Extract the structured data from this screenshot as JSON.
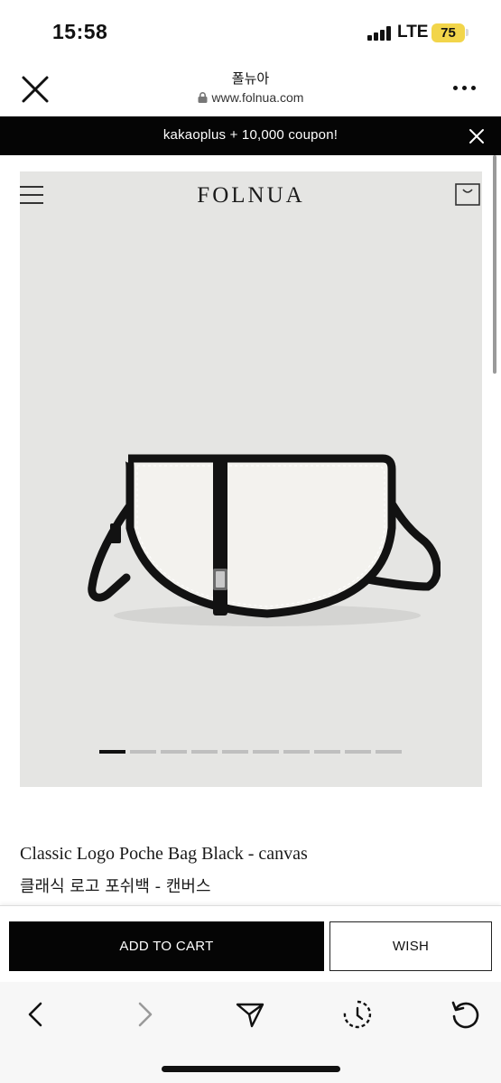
{
  "status_bar": {
    "time": "15:58",
    "network": "LTE",
    "battery": "75"
  },
  "browser": {
    "title": "폴뉴아",
    "url": "www.folnua.com"
  },
  "promo": {
    "text": "kakaoplus + 10,000 coupon!"
  },
  "header": {
    "logo": "FOLNUA"
  },
  "gallery": {
    "image_count": 10,
    "active_index": 0
  },
  "product": {
    "name": "Classic Logo Poche Bag Black - canvas",
    "name_kr": "클래식 로고 포쉬백 - 캔버스"
  },
  "actions": {
    "add_to_cart": "ADD TO CART",
    "wish": "WISH"
  },
  "colors": {
    "accent": "#050505",
    "gallery_bg": "#e5e5e3",
    "battery": "#f2d54a"
  },
  "icons": {
    "close": "close-icon",
    "lock": "lock-icon",
    "more": "more-icon",
    "menu": "hamburger-icon",
    "cart": "shopping-bag-icon",
    "back": "chevron-left-icon",
    "forward": "chevron-right-icon",
    "share": "send-icon",
    "history": "history-icon",
    "reload": "reload-icon"
  }
}
